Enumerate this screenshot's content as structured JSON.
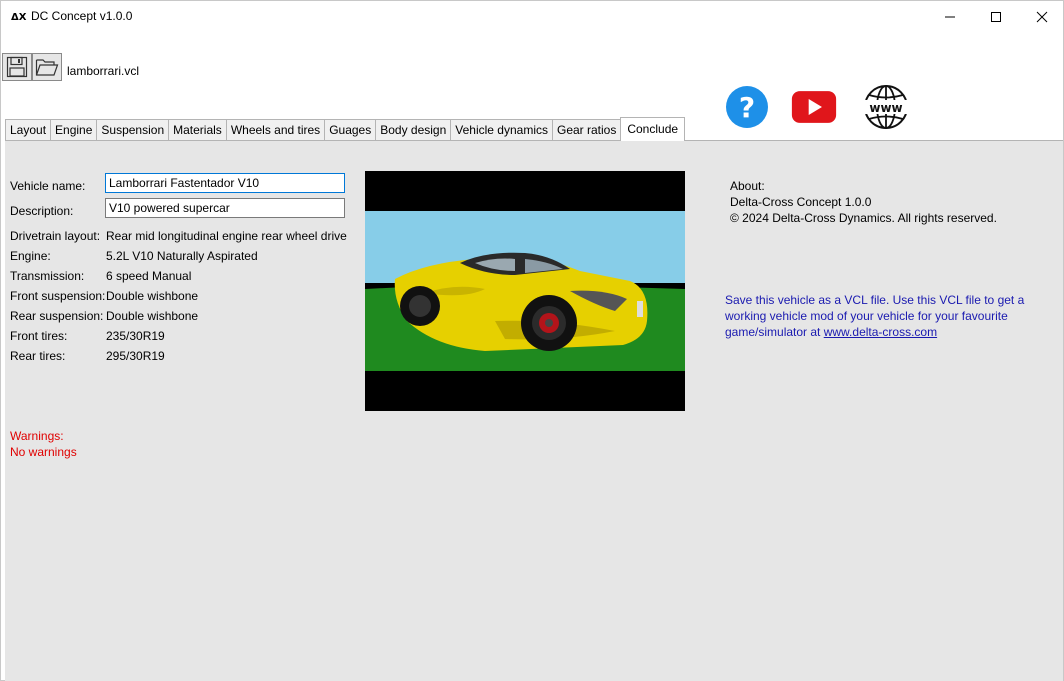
{
  "window": {
    "title": "DC Concept v1.0.0",
    "logo_text": "ΔX"
  },
  "toolbar": {
    "file_name": "lamborrari.vcl"
  },
  "tabs": [
    {
      "label": "Layout"
    },
    {
      "label": "Engine"
    },
    {
      "label": "Suspension"
    },
    {
      "label": "Materials"
    },
    {
      "label": "Wheels and tires"
    },
    {
      "label": "Guages"
    },
    {
      "label": "Body design"
    },
    {
      "label": "Vehicle dynamics"
    },
    {
      "label": "Gear ratios"
    },
    {
      "label": "Conclude"
    }
  ],
  "active_tab": "Conclude",
  "form": {
    "vehicle_name_label": "Vehicle name:",
    "vehicle_name_value": "Lamborrari Fastentador V10",
    "description_label": "Description:",
    "description_value": "V10 powered supercar"
  },
  "specs": [
    {
      "label": "Drivetrain layout:",
      "value": "Rear mid longitudinal engine rear wheel drive"
    },
    {
      "label": "Engine:",
      "value": "5.2L V10 Naturally Aspirated"
    },
    {
      "label": "Transmission:",
      "value": "6 speed Manual"
    },
    {
      "label": "Front suspension:",
      "value": "Double wishbone"
    },
    {
      "label": "Rear suspension:",
      "value": "Double wishbone"
    },
    {
      "label": "Front tires:",
      "value": "235/30R19"
    },
    {
      "label": "Rear tires:",
      "value": "295/30R19"
    }
  ],
  "warnings": {
    "title": "Warnings:",
    "text": "No warnings"
  },
  "about": {
    "title": "About:",
    "product": "Delta-Cross Concept  1.0.0",
    "copyright": "© 2024 Delta-Cross Dynamics. All rights reserved."
  },
  "info": {
    "text": "Save this vehicle as a VCL file. Use this VCL file to get a working vehicle mod of your vehicle for your favourite game/simulator at",
    "link": "www.delta-cross.com"
  },
  "icons": {
    "help": "help-question-icon",
    "youtube": "youtube-icon",
    "web": "www-globe-icon"
  },
  "colors": {
    "warning": "#e00000",
    "info_text": "#1a1ab0",
    "help_blue": "#1e90e8",
    "youtube_red": "#e0161b",
    "car_yellow": "#e6d000",
    "sky": "#87cde8",
    "grass": "#1f8a1f"
  }
}
